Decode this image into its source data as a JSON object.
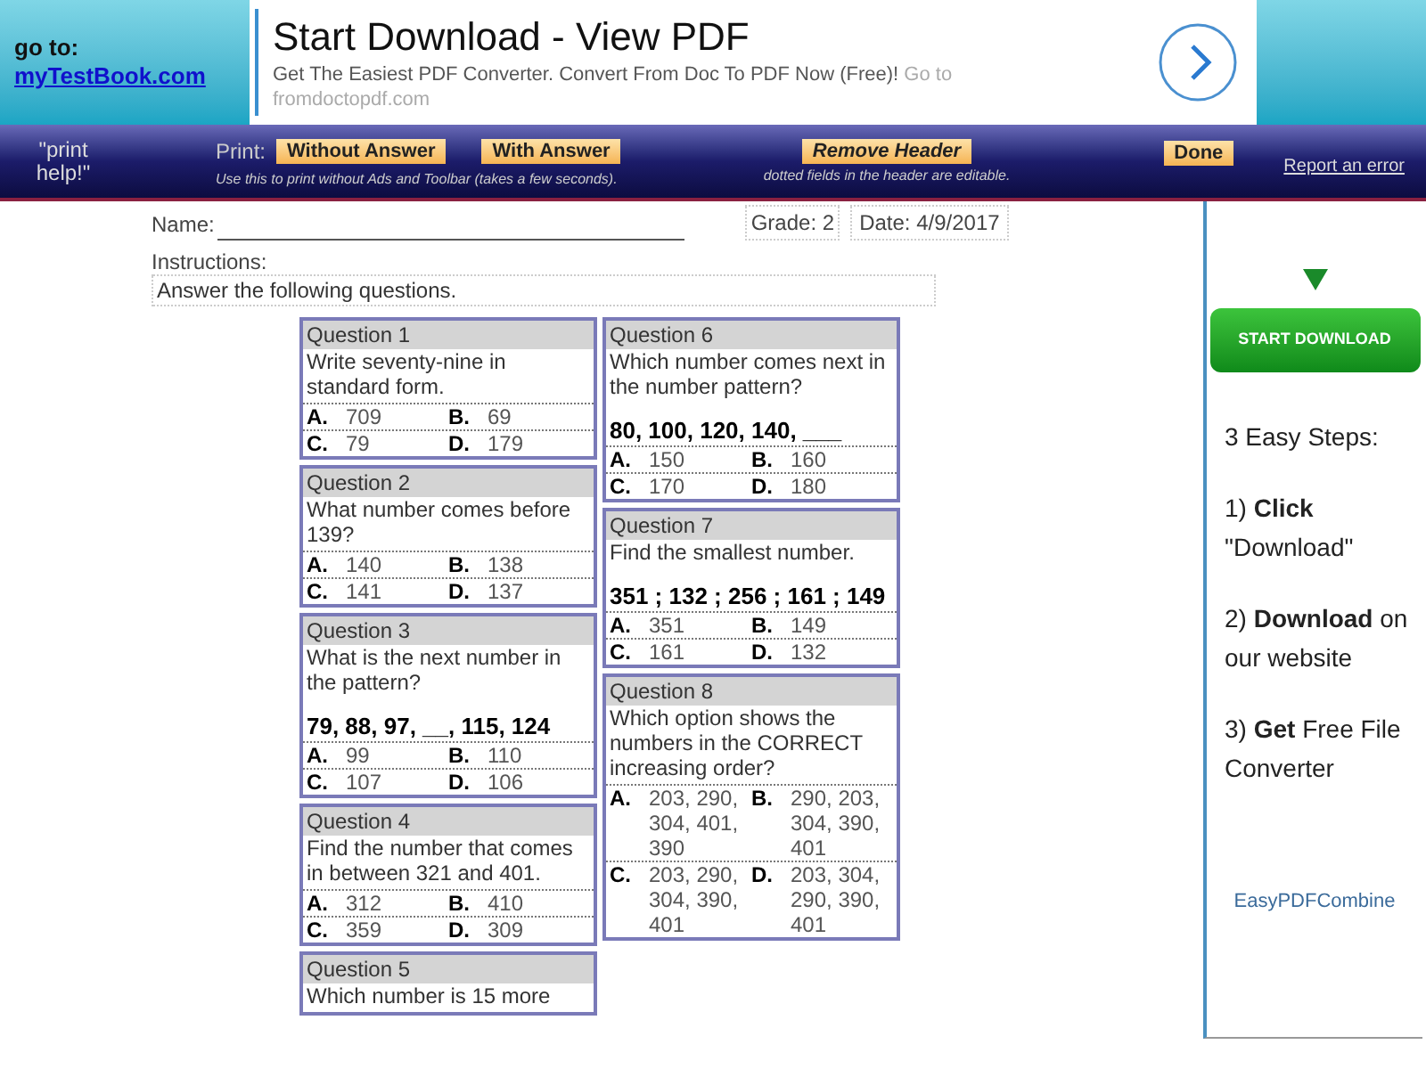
{
  "banner": {
    "goto_label": "go to:",
    "goto_link": "myTestBook.com",
    "ad": {
      "title": "Start Download - View PDF",
      "text": "Get The Easiest PDF Converter. Convert From Doc To PDF Now (Free)!",
      "more": "Go to fromdoctopdf.com"
    }
  },
  "toolbar": {
    "print_help": "\"print help!\"",
    "print_label": "Print:",
    "buttons": [
      {
        "label": "Without Answer",
        "italic": false
      },
      {
        "label": "With Answer",
        "italic": false
      },
      {
        "label": "Remove Header",
        "italic": true
      },
      {
        "label": "Done",
        "italic": false
      }
    ],
    "print_note": "Use this to print without Ads and Toolbar (takes a few seconds).",
    "header_note": "dotted fields in the header are editable.",
    "report": "Report an error"
  },
  "worksheet": {
    "name_label": "Name:",
    "grade_label": "Grade:",
    "grade": "2",
    "date_label": "Date:",
    "date": "4/9/2017",
    "instructions_label": "Instructions:",
    "instructions": "Answer the following questions.",
    "columns": [
      [
        {
          "title": "Question 1",
          "text": "Write seventy-nine in standard form.",
          "options": [
            {
              "letter": "A.",
              "value": "709"
            },
            {
              "letter": "B.",
              "value": "69"
            },
            {
              "letter": "C.",
              "value": "79"
            },
            {
              "letter": "D.",
              "value": "179"
            }
          ]
        },
        {
          "title": "Question 2",
          "text": "What number comes before 139?",
          "options": [
            {
              "letter": "A.",
              "value": "140"
            },
            {
              "letter": "B.",
              "value": "138"
            },
            {
              "letter": "C.",
              "value": "141"
            },
            {
              "letter": "D.",
              "value": "137"
            }
          ]
        },
        {
          "title": "Question 3",
          "text": "What is the next number in the pattern?",
          "pattern": "79, 88, 97, __, 115, 124",
          "options": [
            {
              "letter": "A.",
              "value": "99"
            },
            {
              "letter": "B.",
              "value": "110"
            },
            {
              "letter": "C.",
              "value": "107"
            },
            {
              "letter": "D.",
              "value": "106"
            }
          ]
        },
        {
          "title": "Question 4",
          "text": "Find the number that comes in between 321 and 401.",
          "options": [
            {
              "letter": "A.",
              "value": "312"
            },
            {
              "letter": "B.",
              "value": "410"
            },
            {
              "letter": "C.",
              "value": "359"
            },
            {
              "letter": "D.",
              "value": "309"
            }
          ]
        },
        {
          "title": "Question 5",
          "text": "Which number is 15 more"
        }
      ],
      [
        {
          "title": "Question 6",
          "text": "Which number comes next in the number pattern?",
          "pattern": "80, 100, 120, 140, ___",
          "options": [
            {
              "letter": "A.",
              "value": "150"
            },
            {
              "letter": "B.",
              "value": "160"
            },
            {
              "letter": "C.",
              "value": "170"
            },
            {
              "letter": "D.",
              "value": "180"
            }
          ]
        },
        {
          "title": "Question 7",
          "text": "Find the smallest number.",
          "pattern": "351 ; 132 ; 256 ; 161 ; 149",
          "options": [
            {
              "letter": "A.",
              "value": "351"
            },
            {
              "letter": "B.",
              "value": "149"
            },
            {
              "letter": "C.",
              "value": "161"
            },
            {
              "letter": "D.",
              "value": "132"
            }
          ]
        },
        {
          "title": "Question 8",
          "text": "Which option shows the numbers in the CORRECT increasing order?",
          "options": [
            {
              "letter": "A.",
              "value": "203, 290, 304, 401, 390"
            },
            {
              "letter": "B.",
              "value": "290, 203, 304, 390, 401"
            },
            {
              "letter": "C.",
              "value": "203, 290, 304, 390, 401"
            },
            {
              "letter": "D.",
              "value": "203, 304, 290, 390, 401"
            }
          ]
        }
      ]
    ]
  },
  "side_ad": {
    "button": "START DOWNLOAD",
    "heading": "3 Easy Steps:",
    "steps": [
      "1) **Click** \"Download\"",
      "2) **Download** on our website",
      "3) **Get** Free File Converter"
    ],
    "logo": "EasyPDFCombine"
  }
}
